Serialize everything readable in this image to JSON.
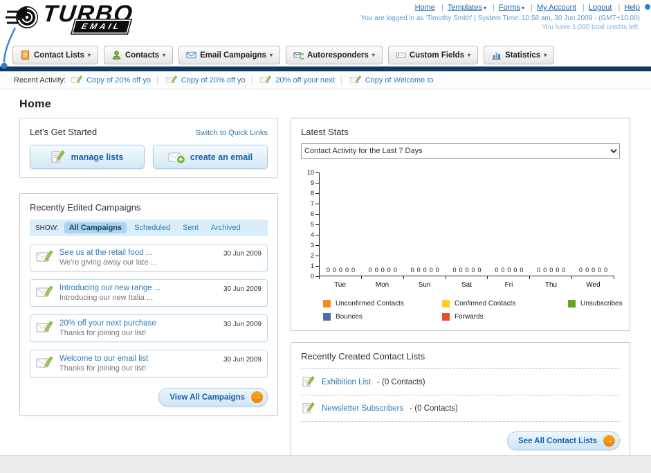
{
  "header": {
    "logo_line1": "TURBO",
    "logo_line2": "EMAIL",
    "top_links": [
      {
        "label": "Home"
      },
      {
        "label": "Templates"
      },
      {
        "label": "Forms"
      },
      {
        "label": "My Account"
      },
      {
        "label": "Logout"
      },
      {
        "label": "Help"
      }
    ],
    "login_info": "You are logged in as 'Timothy Smith' | System Time: 10:58 am, 30 Jun 2009 - (GMT+10:00)",
    "credits_info": "You have 1,000 total credits left."
  },
  "nav": {
    "items": [
      {
        "label": "Contact Lists"
      },
      {
        "label": "Contacts"
      },
      {
        "label": "Email Campaigns"
      },
      {
        "label": "Autoresponders"
      },
      {
        "label": "Custom Fields"
      },
      {
        "label": "Statistics"
      }
    ]
  },
  "recent_activity": {
    "label": "Recent Activity:",
    "items": [
      "Copy of 20% off yo",
      "Copy of 20% off yo",
      "20% off your next",
      "Copy of Welcome to"
    ]
  },
  "page_title": "Home",
  "get_started": {
    "title": "Let's Get Started",
    "switch_link": "Switch to Quick Links",
    "manage_lists_label": "manage lists",
    "create_email_label": "create an email"
  },
  "campaigns": {
    "title": "Recently Edited Campaigns",
    "show_label": "SHOW:",
    "tabs": [
      "All Campaigns",
      "Scheduled",
      "Sent",
      "Archived"
    ],
    "active_tab": "All Campaigns",
    "items": [
      {
        "title": "See us at the retail food ...",
        "subtitle": "We're giving away our late ...",
        "date": "30 Jun 2009"
      },
      {
        "title": "Introducing our new range ...",
        "subtitle": "Introducing our new Italia ...",
        "date": "30 Jun 2009"
      },
      {
        "title": "20% off your next purchase",
        "subtitle": "Thanks for joining our list!",
        "date": "30 Jun 2009"
      },
      {
        "title": "Welcome to our email list",
        "subtitle": "Thanks for joining our list!",
        "date": "30 Jun 2009"
      }
    ],
    "view_all_label": "View All Campaigns"
  },
  "latest_stats": {
    "title": "Latest Stats",
    "dropdown_value": "Contact Activity for the Last 7 Days",
    "chart_data": {
      "type": "bar",
      "categories": [
        "Tue",
        "Mon",
        "Sun",
        "Sat",
        "Fri",
        "Thu",
        "Wed"
      ],
      "series": [
        {
          "name": "Unconfirmed Contacts",
          "color": "#f68b1f",
          "values": [
            0,
            0,
            0,
            0,
            0,
            0,
            0
          ]
        },
        {
          "name": "Confirmed Contacts",
          "color": "#fcd116",
          "values": [
            0,
            0,
            0,
            0,
            0,
            0,
            0
          ]
        },
        {
          "name": "Unsubscribes",
          "color": "#6aa121",
          "values": [
            0,
            0,
            0,
            0,
            0,
            0,
            0
          ]
        },
        {
          "name": "Bounces",
          "color": "#4f6fa8",
          "values": [
            0,
            0,
            0,
            0,
            0,
            0,
            0
          ]
        },
        {
          "name": "Forwards",
          "color": "#e8502a",
          "values": [
            0,
            0,
            0,
            0,
            0,
            0,
            0
          ]
        }
      ],
      "ylim": [
        0,
        10
      ],
      "yticks": [
        0,
        1,
        2,
        3,
        4,
        5,
        6,
        7,
        8,
        9,
        10
      ],
      "legend_position": "bottom",
      "grid": false
    }
  },
  "contact_lists": {
    "title": "Recently Created Contact Lists",
    "items": [
      {
        "name": "Exhibition List",
        "detail": "- (0 Contacts)"
      },
      {
        "name": "Newsletter Subscribers",
        "detail": "- (0 Contacts)"
      }
    ],
    "see_all_label": "See All Contact Lists"
  }
}
